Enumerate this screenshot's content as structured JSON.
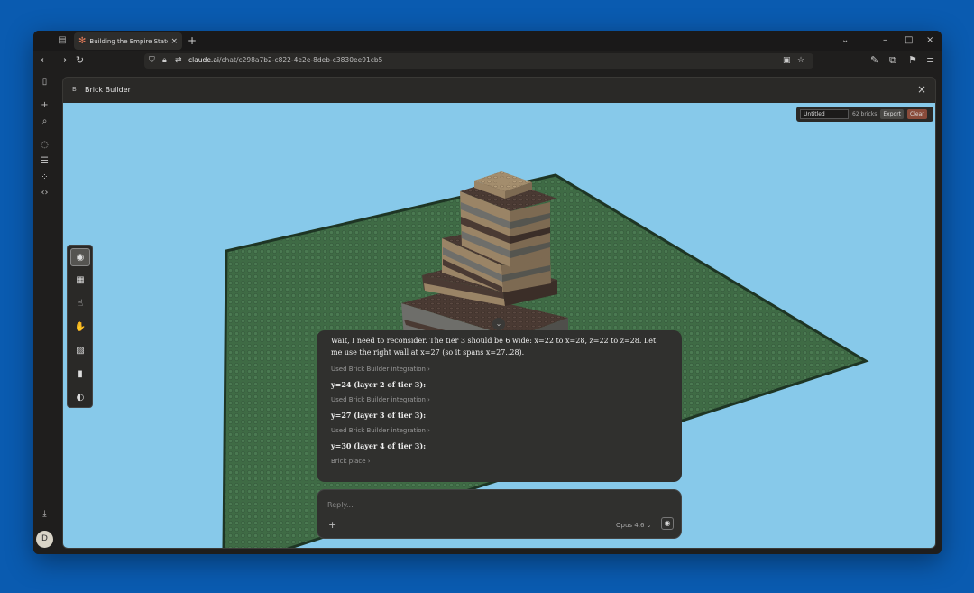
{
  "browser": {
    "tab_title": "Building the Empire State Build",
    "url_domain": "claude.ai",
    "url_path": "/chat/c298a7b2-c822-4e2e-8deb-c3830ee91cb5"
  },
  "icons": {
    "tab_favicon": "✻",
    "tab_close": "×",
    "new_tab": "+",
    "chevron": "⌄",
    "minimize": "–",
    "maximize": "□",
    "close": "×",
    "back": "←",
    "forward": "→",
    "reload": "↻",
    "menu": "≡",
    "plus": "+",
    "arrow_right": "›",
    "arrow_down": "⌄"
  },
  "sidebar": {
    "avatar_initial": "D"
  },
  "artifact": {
    "title": "Brick Builder",
    "icon_letter": "B",
    "project_name": "Untitled",
    "brick_count": "62 bricks",
    "export_label": "Export",
    "clear_label": "Clear"
  },
  "chat": {
    "paragraph": "Wait, I need to reconsider. The tier 3 should be 6 wide: x=22 to x=28, z=22 to z=28. Let me use the right wall at x=27 (so it spans x=27..28).",
    "items": [
      {
        "used": "Used Brick Builder integration ›",
        "heading": "y=24 (layer 2 of tier 3):"
      },
      {
        "used": "Used Brick Builder integration ›",
        "heading": "y=27 (layer 3 of tier 3):"
      },
      {
        "used": "Used Brick Builder integration ›",
        "heading": "y=30 (layer 4 of tier 3):"
      }
    ],
    "final_tool": "Brick place ›"
  },
  "composer": {
    "placeholder": "Reply...",
    "model": "Opus 4.6 ⌄"
  },
  "colors": {
    "desktop": "#0a5bb0",
    "sky": "#87c9ea",
    "baseplate": "#3f6b45",
    "brick_dark": "#4a3a33",
    "brick_tan": "#9a8466",
    "brick_gray": "#6e6e6a"
  }
}
